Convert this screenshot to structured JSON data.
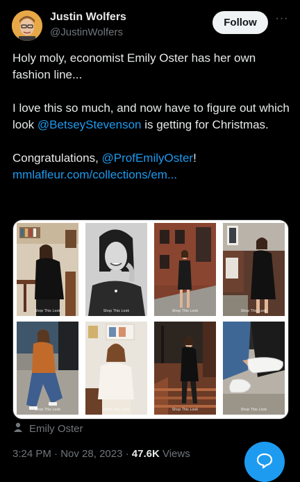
{
  "author": {
    "name": "Justin Wolfers",
    "handle": "@JustinWolfers",
    "follow_label": "Follow",
    "more_label": "···"
  },
  "tweet": {
    "p1": "Holy moly, economist Emily Oster has her own fashion line...",
    "p2_before": "I love this so much, and now have to figure out which look ",
    "p2_mention": "@BetseyStevenson",
    "p2_after": " is getting for Christmas.",
    "p3_before": "Congratulations, ",
    "p3_mention": "@ProfEmilyOster",
    "p3_after": "!",
    "link": "mmlafleur.com/collections/em..."
  },
  "media": {
    "shop_label": "Shop This Look",
    "tiles": 8
  },
  "attribution": {
    "icon": "person-icon",
    "name": "Emily Oster"
  },
  "meta": {
    "time": "3:24 PM",
    "sep1": " · ",
    "date": "Nov 28, 2023",
    "sep2": " · ",
    "views_count": "47.6K",
    "views_label": " Views"
  },
  "colors": {
    "accent": "#1d9bf0",
    "background": "#000000",
    "muted": "#71767b"
  }
}
